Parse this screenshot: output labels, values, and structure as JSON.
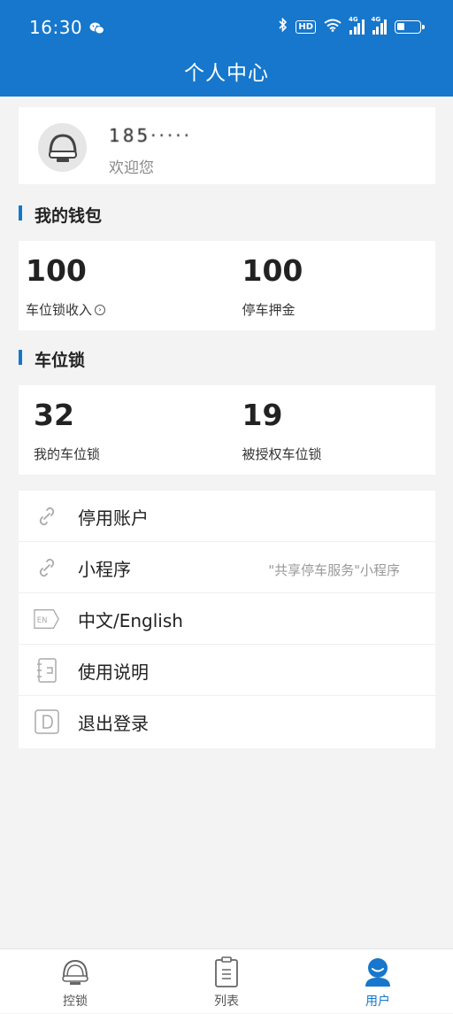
{
  "status_bar": {
    "time": "16:30",
    "hd": "HD",
    "signal1": "4G",
    "signal2": "4G"
  },
  "header": {
    "title": "个人中心"
  },
  "profile": {
    "phone": "185·····",
    "welcome": "欢迎您"
  },
  "wallet": {
    "title": "我的钱包",
    "income": {
      "value": "100",
      "label": "车位锁收入"
    },
    "deposit": {
      "value": "100",
      "label": "停车押金"
    }
  },
  "locks": {
    "title": "车位锁",
    "mine": {
      "value": "32",
      "label": "我的车位锁"
    },
    "authorized": {
      "value": "19",
      "label": "被授权车位锁"
    }
  },
  "menu": [
    {
      "label": "停用账户",
      "icon": "link-icon"
    },
    {
      "label": "小程序",
      "sub": "\"共享停车服务\"小程序",
      "icon": "link-icon"
    },
    {
      "label": "中文/English",
      "icon": "language-icon"
    },
    {
      "label": "使用说明",
      "icon": "notebook-icon"
    },
    {
      "label": "退出登录",
      "icon": "logout-icon"
    }
  ],
  "tabs": [
    {
      "label": "控锁",
      "icon": "lock-control-icon"
    },
    {
      "label": "列表",
      "icon": "list-icon"
    },
    {
      "label": "用户",
      "icon": "user-icon"
    }
  ],
  "colors": {
    "primary": "#1677cc",
    "background": "#f3f3f3"
  }
}
